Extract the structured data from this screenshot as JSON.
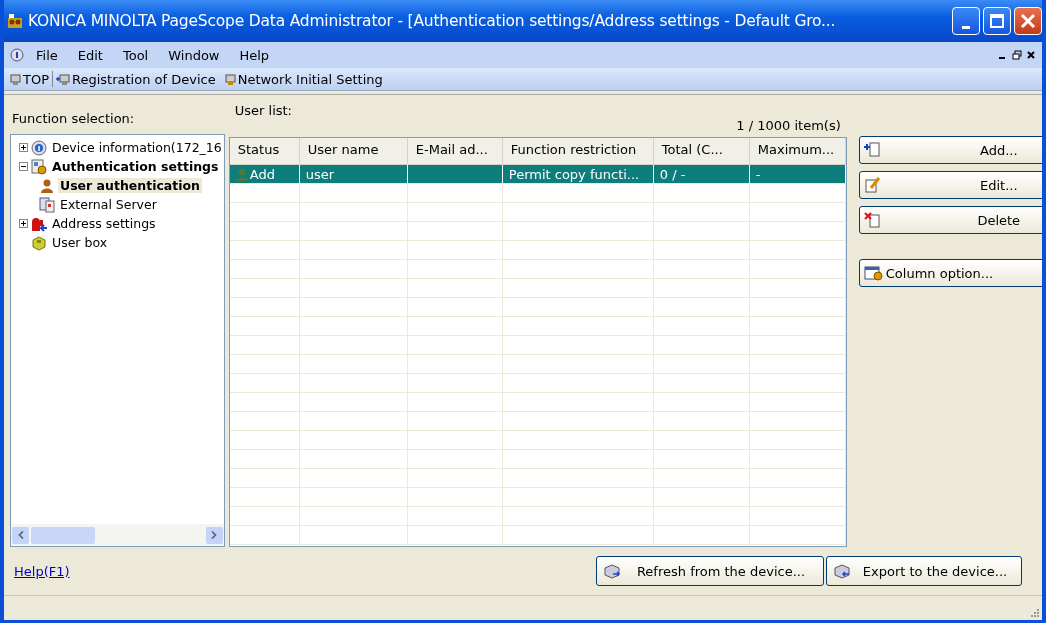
{
  "window": {
    "title": "KONICA MINOLTA PageScope Data Administrator - [Authentication settings/Address settings - Default Gro..."
  },
  "menu": [
    "File",
    "Edit",
    "Tool",
    "Window",
    "Help"
  ],
  "toolbar": [
    "TOP",
    "Registration of Device",
    "Network Initial Setting"
  ],
  "sidebar": {
    "label": "Function selection:",
    "tree": [
      {
        "label": "Device information(172_16",
        "kind": "info",
        "expanded": false,
        "bold": false,
        "selected": false
      },
      {
        "label": "Authentication settings",
        "kind": "auth",
        "expanded": true,
        "bold": true,
        "selected": false,
        "children": [
          {
            "label": "User authentication",
            "kind": "user",
            "bold": true,
            "selected": true
          },
          {
            "label": "External Server",
            "kind": "server",
            "bold": false,
            "selected": false
          }
        ]
      },
      {
        "label": "Address settings",
        "kind": "address",
        "expanded": false,
        "bold": false,
        "selected": false
      },
      {
        "label": "User box",
        "kind": "box",
        "bold": false,
        "selected": false
      }
    ]
  },
  "user_list": {
    "label": "User list:",
    "count": "1 / 1000 item(s)",
    "columns": [
      "Status",
      "User name",
      "E-Mail ad...",
      "Function restriction",
      "Total (C...",
      "Maximum..."
    ],
    "rows": [
      {
        "selected": true,
        "cells": [
          "Add",
          "user",
          "",
          "Permit copy functi...",
          "0 / -",
          "-"
        ]
      }
    ]
  },
  "actions": [
    {
      "label": "Add...",
      "kind": "add"
    },
    {
      "label": "Edit...",
      "kind": "edit"
    },
    {
      "label": "Delete",
      "kind": "delete"
    },
    {
      "label": "Column option...",
      "kind": "columns"
    }
  ],
  "footer": {
    "help_link": "Help(F1)",
    "buttons": [
      "Refresh from the device...",
      "Export to the device..."
    ]
  }
}
